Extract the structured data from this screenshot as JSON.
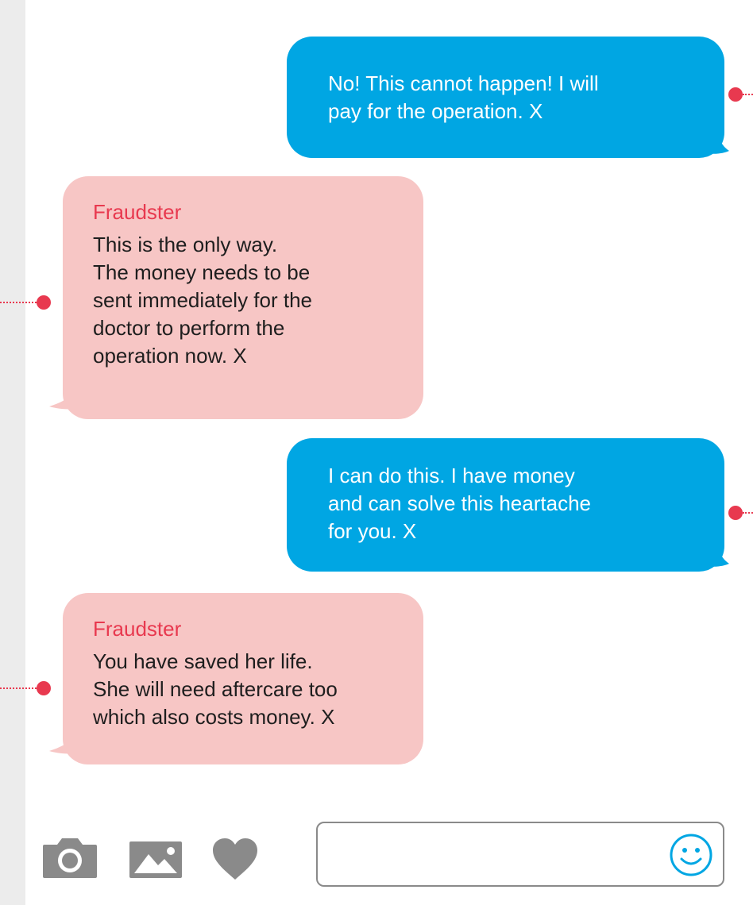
{
  "conversation": {
    "messages": [
      {
        "direction": "sent",
        "sender": "",
        "text": "No! This cannot happen! I will\npay for the operation. X"
      },
      {
        "direction": "received",
        "sender": "Fraudster",
        "text": "This is the only way.\nThe money needs to be\nsent immediately for the\ndoctor to perform the\noperation now. X"
      },
      {
        "direction": "sent",
        "sender": "",
        "text": "I can do this. I have money\nand can solve this heartache\nfor you. X"
      },
      {
        "direction": "received",
        "sender": "Fraudster",
        "text": "You have saved her life.\nShe will need aftercare too\nwhich also costs money. X"
      }
    ]
  },
  "composer": {
    "placeholder": "",
    "value": "",
    "icons": [
      "camera-icon",
      "image-icon",
      "heart-icon",
      "smiley-face-icon"
    ]
  },
  "colors": {
    "sent_bubble": "#00a6e3",
    "received_bubble": "#f7c6c5",
    "sender_name": "#e8394f",
    "annotation_marker": "#e8394f",
    "toolbar_icon": "#8a8a8a"
  }
}
